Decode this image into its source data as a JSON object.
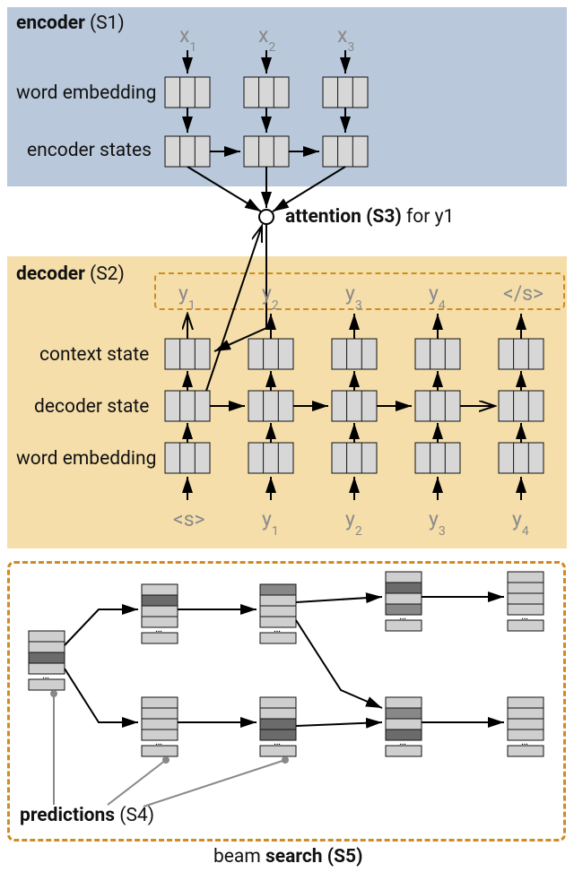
{
  "encoder": {
    "title_a": "encoder",
    "title_b": " (S1)",
    "x": [
      "x",
      "x",
      "x"
    ],
    "xi": [
      "1",
      "2",
      "3"
    ],
    "row1": "word embedding",
    "row2": "encoder states"
  },
  "attention": {
    "label_a": "attention (S3)",
    "label_b": " for y1"
  },
  "decoder": {
    "title_a": "decoder",
    "title_b": " (S2)",
    "out": [
      "y",
      "y",
      "y",
      "y",
      "</s>"
    ],
    "outi": [
      "1",
      "2",
      "3",
      "4",
      ""
    ],
    "row1": "context state",
    "row2": "decoder state",
    "row3": "word embedding",
    "in": [
      "<s>",
      "y",
      "y",
      "y",
      "y"
    ],
    "ini": [
      "",
      "1",
      "2",
      "3",
      "4"
    ]
  },
  "beam": {
    "pred_a": "predictions",
    "pred_b": " (S4)",
    "label_a": "beam ",
    "label_b": "search (S5)"
  }
}
